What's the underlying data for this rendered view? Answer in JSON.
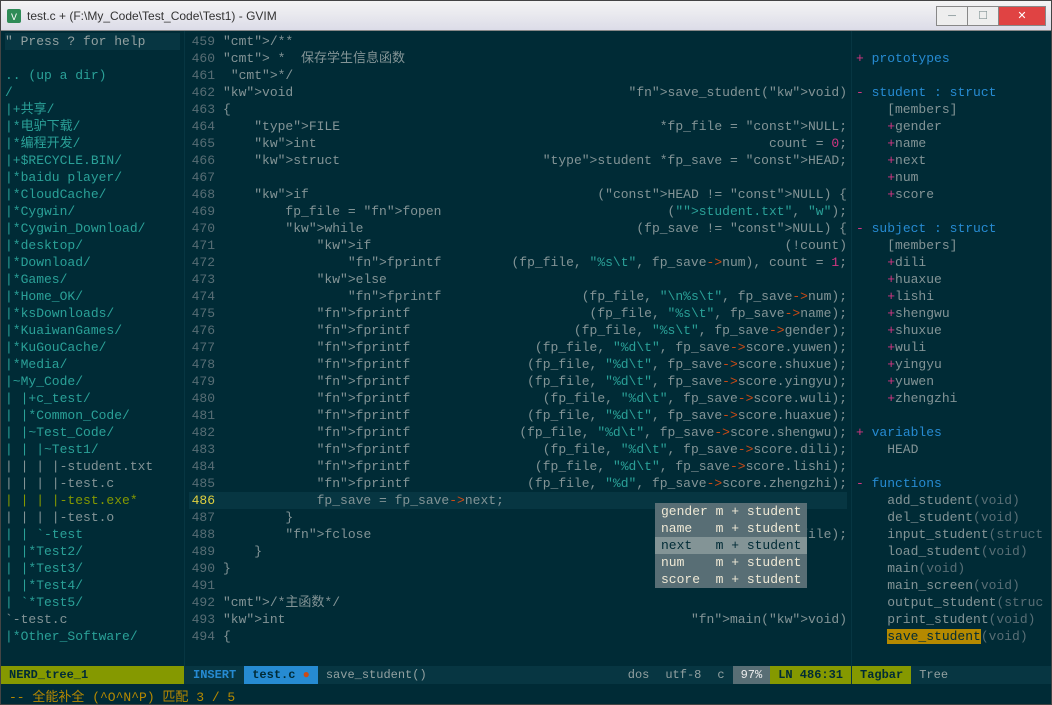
{
  "titlebar": {
    "title": "test.c + (F:\\My_Code\\Test_Code\\Test1) - GVIM"
  },
  "nerd": {
    "header": "\" Press ? for help",
    "lines": [
      ".. (up a dir)",
      "/",
      "|+共享/",
      "|*电驴下载/",
      "|*编程开发/",
      "|+$RECYCLE.BIN/",
      "|*baidu player/",
      "|*CloudCache/",
      "|*Cygwin/",
      "|*Cygwin_Download/",
      "|*desktop/",
      "|*Download/",
      "|*Games/",
      "|*Home_OK/",
      "|*ksDownloads/",
      "|*KuaiwanGames/",
      "|*KuGouCache/",
      "|*Media/",
      "|~My_Code/",
      "| |+c_test/",
      "| |*Common_Code/",
      "| |~Test_Code/",
      "| | |~Test1/",
      "| | | |-student.txt",
      "| | | |-test.c",
      "| | | |-test.exe*",
      "| | | |-test.o",
      "| | `-test",
      "| |*Test2/",
      "| |*Test3/",
      "| |*Test4/",
      "| `*Test5/",
      "`-test.c",
      "|*Other_Software/"
    ],
    "status": "NERD_tree_1"
  },
  "code": {
    "lines": [
      {
        "n": 459,
        "t": "/**"
      },
      {
        "n": 460,
        "t": " *  保存学生信息函数"
      },
      {
        "n": 461,
        "t": " */"
      },
      {
        "n": 462,
        "t": "void save_student(void)"
      },
      {
        "n": 463,
        "t": "{"
      },
      {
        "n": 464,
        "t": "    FILE *fp_file = NULL;"
      },
      {
        "n": 465,
        "t": "    int count = 0;"
      },
      {
        "n": 466,
        "t": "    struct student *fp_save = HEAD;"
      },
      {
        "n": 467,
        "t": ""
      },
      {
        "n": 468,
        "t": "    if (HEAD != NULL) {"
      },
      {
        "n": 469,
        "t": "        fp_file = fopen(\"student.txt\", \"w\");"
      },
      {
        "n": 470,
        "t": "        while (fp_save != NULL) {"
      },
      {
        "n": 471,
        "t": "            if (!count)"
      },
      {
        "n": 472,
        "t": "                fprintf(fp_file, \"%s\\t\", fp_save->num), count = 1;"
      },
      {
        "n": 473,
        "t": "            else"
      },
      {
        "n": 474,
        "t": "                fprintf(fp_file, \"\\n%s\\t\", fp_save->num);"
      },
      {
        "n": 475,
        "t": "            fprintf(fp_file, \"%s\\t\", fp_save->name);"
      },
      {
        "n": 476,
        "t": "            fprintf(fp_file, \"%s\\t\", fp_save->gender);"
      },
      {
        "n": 477,
        "t": "            fprintf(fp_file, \"%d\\t\", fp_save->score.yuwen);"
      },
      {
        "n": 478,
        "t": "            fprintf(fp_file, \"%d\\t\", fp_save->score.shuxue);"
      },
      {
        "n": 479,
        "t": "            fprintf(fp_file, \"%d\\t\", fp_save->score.yingyu);"
      },
      {
        "n": 480,
        "t": "            fprintf(fp_file, \"%d\\t\", fp_save->score.wuli);"
      },
      {
        "n": 481,
        "t": "            fprintf(fp_file, \"%d\\t\", fp_save->score.huaxue);"
      },
      {
        "n": 482,
        "t": "            fprintf(fp_file, \"%d\\t\", fp_save->score.shengwu);"
      },
      {
        "n": 483,
        "t": "            fprintf(fp_file, \"%d\\t\", fp_save->score.dili);"
      },
      {
        "n": 484,
        "t": "            fprintf(fp_file, \"%d\\t\", fp_save->score.lishi);"
      },
      {
        "n": 485,
        "t": "            fprintf(fp_file, \"%d\", fp_save->score.zhengzhi);"
      },
      {
        "n": 486,
        "t": "            fp_save = fp_save->next;",
        "cur": true
      },
      {
        "n": 487,
        "t": "        }"
      },
      {
        "n": 488,
        "t": "        fclose(fp_file);"
      },
      {
        "n": 489,
        "t": "    }"
      },
      {
        "n": 490,
        "t": "}"
      },
      {
        "n": 491,
        "t": ""
      },
      {
        "n": 492,
        "t": "/*主函数*/"
      },
      {
        "n": 493,
        "t": "int main(void)"
      },
      {
        "n": 494,
        "t": "{"
      }
    ],
    "status": {
      "mode": "INSERT",
      "file": "test.c",
      "mod": "●",
      "fn": "save_student()",
      "ff": "dos",
      "enc": "utf-8",
      "ft": "c",
      "pct": "97%",
      "pos": "LN 486:31"
    }
  },
  "popup": {
    "items": [
      {
        "k": "gender",
        "v": "m + student"
      },
      {
        "k": "name",
        "v": "m + student"
      },
      {
        "k": "next",
        "v": "m + student",
        "sel": true
      },
      {
        "k": "num",
        "v": "m + student"
      },
      {
        "k": "score",
        "v": "m + student"
      }
    ]
  },
  "tagbar": {
    "sections": [
      {
        "h": "prototypes"
      },
      {
        "h": "student : struct",
        "sub": "[members]",
        "items": [
          "gender",
          "name",
          "next",
          "num",
          "score"
        ]
      },
      {
        "h": "subject : struct",
        "sub": "[members]",
        "items": [
          "dili",
          "huaxue",
          "lishi",
          "shengwu",
          "shuxue",
          "wuli",
          "yingyu",
          "yuwen",
          "zhengzhi"
        ]
      },
      {
        "h": "variables",
        "items2": [
          "HEAD"
        ]
      },
      {
        "h": "functions",
        "fns": [
          {
            "n": "add_student",
            "p": "(void)"
          },
          {
            "n": "del_student",
            "p": "(void)"
          },
          {
            "n": "input_student",
            "p": "(struct"
          },
          {
            "n": "load_student",
            "p": "(void)"
          },
          {
            "n": "main",
            "p": "(void)"
          },
          {
            "n": "main_screen",
            "p": "(void)"
          },
          {
            "n": "output_student",
            "p": "(struc"
          },
          {
            "n": "print_student",
            "p": "(void)"
          },
          {
            "n": "save_student",
            "p": "(void)",
            "hl": true
          }
        ]
      }
    ],
    "status": {
      "a": "Tagbar",
      "b": "Tree"
    }
  },
  "cmdline": "-- 全能补全 (^O^N^P) 匹配 3 / 5"
}
